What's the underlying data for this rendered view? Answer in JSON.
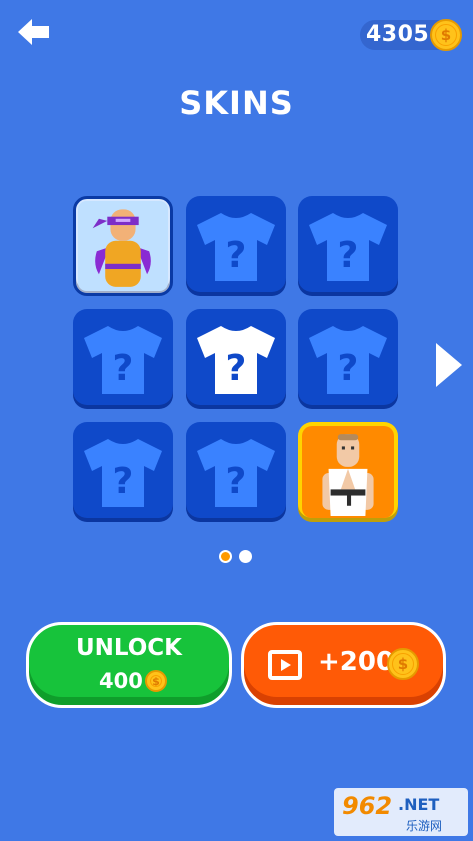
{
  "header": {
    "back_icon": "arrow-left-icon",
    "coins": "4305",
    "coin_icon": "coin-icon"
  },
  "page": {
    "title": "SKINS"
  },
  "skins": [
    {
      "state": "owned",
      "character": "ninja-purple-headband",
      "icon": "character-ninja-icon"
    },
    {
      "state": "locked",
      "icon": "tshirt-question-icon"
    },
    {
      "state": "locked",
      "icon": "tshirt-question-icon"
    },
    {
      "state": "locked",
      "icon": "tshirt-question-icon"
    },
    {
      "state": "locked-highlighted",
      "icon": "tshirt-question-white-icon"
    },
    {
      "state": "locked",
      "icon": "tshirt-question-icon"
    },
    {
      "state": "locked",
      "icon": "tshirt-question-icon"
    },
    {
      "state": "locked",
      "icon": "tshirt-question-icon"
    },
    {
      "state": "selected",
      "character": "karate-white-gi",
      "icon": "character-karate-icon"
    }
  ],
  "pagination": {
    "pages": 2,
    "current": 1
  },
  "next_icon": "chevron-right-icon",
  "actions": {
    "unlock_label": "UNLOCK",
    "unlock_price": "400",
    "reward_icon": "video-play-icon",
    "reward_label": "+200"
  },
  "watermark": {
    "brand": "962.NET",
    "sub": "乐游网"
  },
  "colors": {
    "background": "#3f78e6",
    "tile": "#0f49c9",
    "unlock_green": "#17c33b",
    "reward_orange": "#ff5a06",
    "coin_gold": "#ffc21a",
    "page_dot_active": "#ff9a00"
  }
}
